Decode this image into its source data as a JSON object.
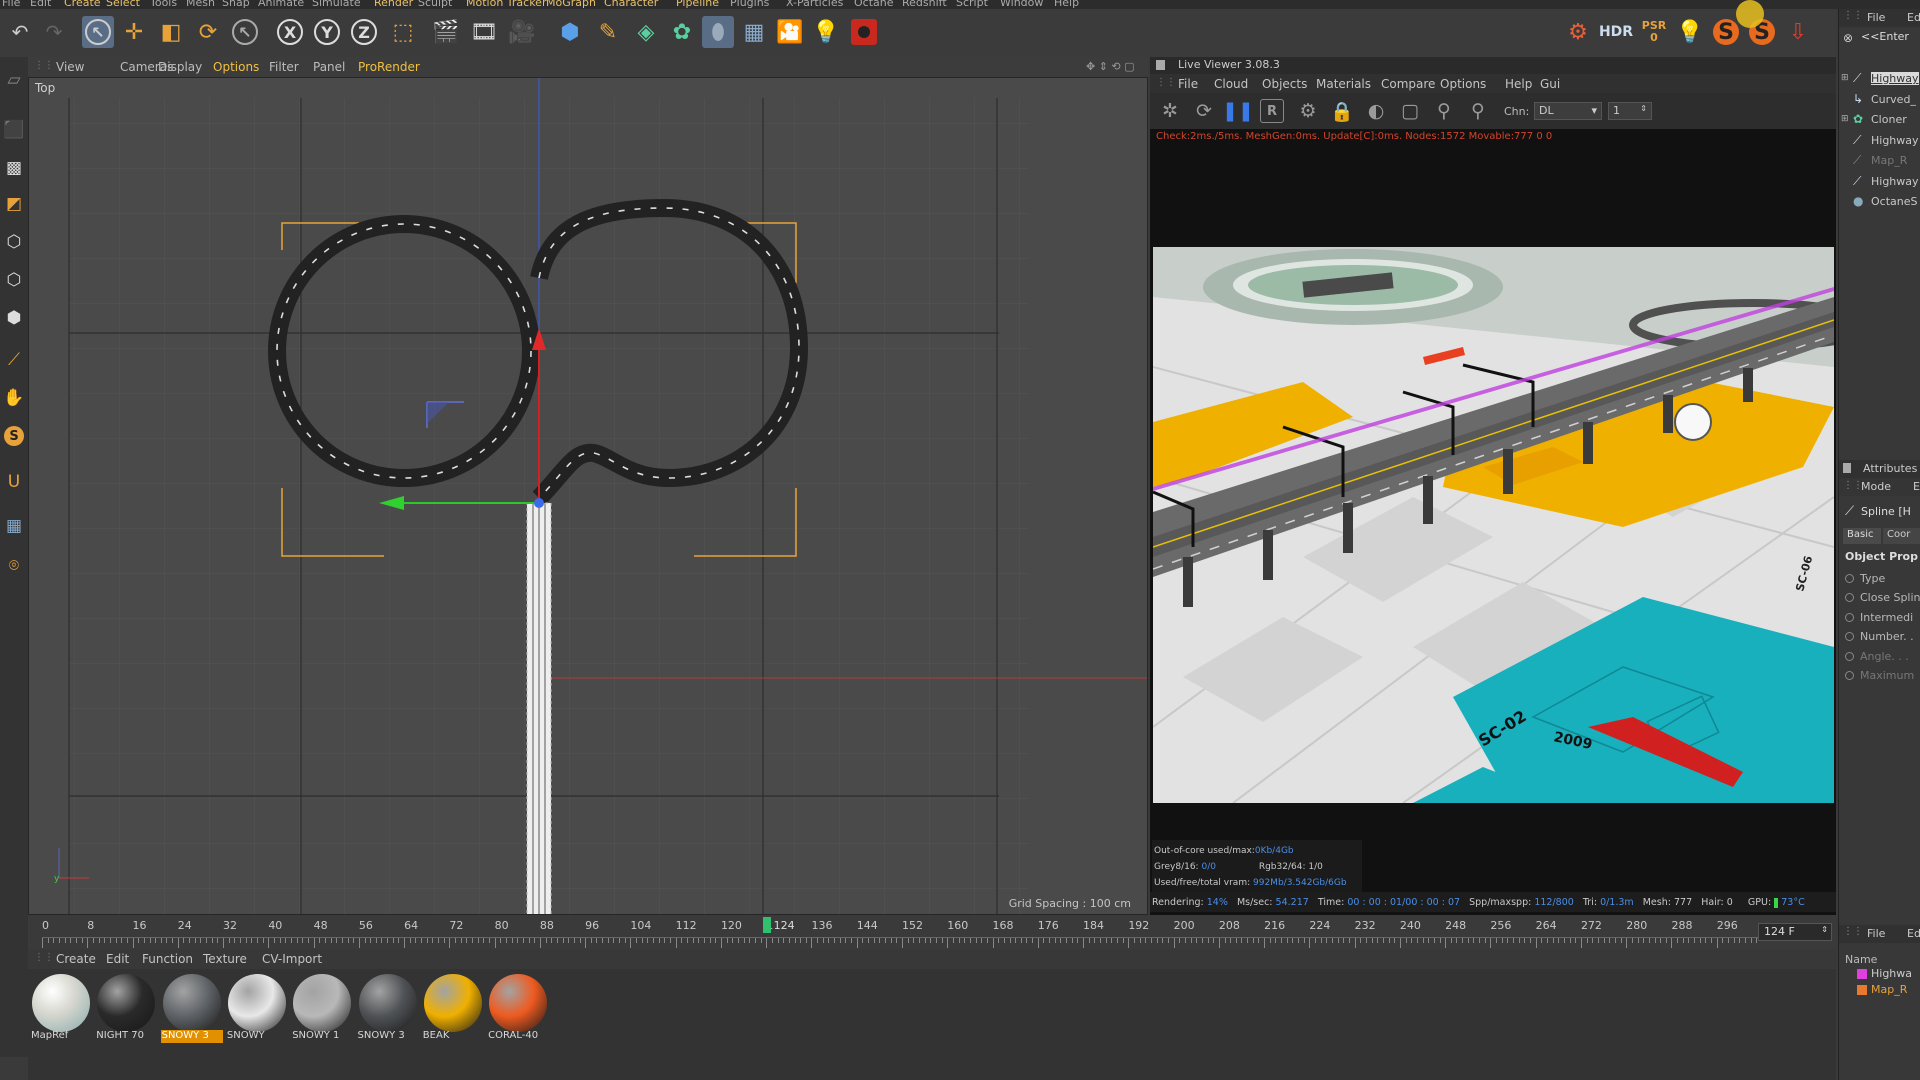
{
  "menubar": [
    "File",
    "Edit",
    "Create",
    "Select",
    "Tools",
    "Mesh",
    "Snap",
    "Animate",
    "Simulate",
    "Render",
    "Sculpt",
    "Motion Tracker",
    "MoGraph",
    "Character",
    "Pipeline",
    "Plugins",
    "X-Particles",
    "Octane",
    "Redshift",
    "Script",
    "Window",
    "Help"
  ],
  "viewport": {
    "menu": [
      "View",
      "Cameras",
      "Display",
      "Options",
      "Filter",
      "Panel",
      "ProRender"
    ],
    "label": "Top",
    "grid_spacing": "Grid Spacing : 100 cm"
  },
  "live_viewer": {
    "title": "Live Viewer 3.08.3",
    "menu": [
      "File",
      "Cloud",
      "Objects",
      "Materials",
      "Compare",
      "Options",
      "Help",
      "Gui"
    ],
    "chn_label": "Chn:",
    "chn_value": "DL",
    "chn_num": "1",
    "status": "Check:2ms./5ms. MeshGen:0ms. Update[C]:0ms. Nodes:1572 Movable:777  0 0",
    "render_labels": [
      "SC-02",
      "2009",
      "SC-06"
    ],
    "info": {
      "ooc_label": "Out-of-core used/max:",
      "ooc_value": "0Kb/4Gb",
      "grey_label": "Grey8/16:",
      "grey_value": "0/0",
      "rgb_label": "Rgb32/64:",
      "rgb_value": "1/0",
      "vram_label": "Used/free/total vram:",
      "vram_value": "992Mb/3.542Gb/6Gb"
    },
    "bottom": {
      "rendering": "Rendering:",
      "rendering_v": "14%",
      "mssec": "Ms/sec:",
      "mssec_v": "54.217",
      "time": "Time:",
      "time_v": "00 : 00 : 01/00 : 00 : 07",
      "spp": "Spp/maxspp:",
      "spp_v": "112/800",
      "tri": "Tri:",
      "tri_v": "0/1.3m",
      "mesh": "Mesh:",
      "mesh_v": "777",
      "hair": "Hair:",
      "hair_v": "0",
      "gpu": "GPU:",
      "gpu_v": "73°C"
    }
  },
  "object_manager": {
    "menu": [
      "File",
      "Edit"
    ],
    "search": "<<Enter",
    "items": [
      "Highway",
      "Curved_",
      "Cloner",
      "Highway",
      "Map_R",
      "Highway",
      "OctaneS"
    ]
  },
  "attributes": {
    "title": "Attributes",
    "mode": "Mode",
    "mode2": "E",
    "object": "Spline [H",
    "tabs": [
      "Basic",
      "Coor"
    ],
    "section": "Object Prop",
    "rows": [
      "Type",
      "Close Splin",
      "Intermedi",
      "Number. .",
      "Angle. . .",
      "Maximum"
    ]
  },
  "layers": {
    "menu": [
      "File",
      "Edit"
    ],
    "name_hdr": "Name",
    "items": [
      "Highwa",
      "Map_R"
    ]
  },
  "timeline": {
    "ticks": [
      "0",
      "8",
      "16",
      "24",
      "32",
      "40",
      "48",
      "56",
      "64",
      "72",
      "80",
      "88",
      "96",
      "104",
      "112",
      "120",
      "128",
      "136",
      "144",
      "152",
      "160",
      "168",
      "176",
      "184",
      "192",
      "200",
      "208",
      "216",
      "224",
      "232",
      "240",
      "248",
      "256",
      "264",
      "272",
      "280",
      "288",
      "296"
    ],
    "current": "124",
    "current_frac": 0.419,
    "end": "124 F"
  },
  "materials": {
    "menu": [
      "Create",
      "Edit",
      "Function",
      "Texture",
      "CV-Import"
    ],
    "items": [
      {
        "name": "MapRef",
        "color": "#d8d8d0"
      },
      {
        "name": "NIGHT 70",
        "color": "#2a2a2a"
      },
      {
        "name": "SNOWY 3",
        "color": "#606468"
      },
      {
        "name": "SNOWY",
        "color": "#e8e8e8"
      },
      {
        "name": "SNOWY 1",
        "color": "#b8b8b8"
      },
      {
        "name": "SNOWY 3",
        "color": "#505356"
      },
      {
        "name": "BEAK",
        "color": "#f0b000"
      },
      {
        "name": "CORAL-40",
        "color": "#ee5a20"
      }
    ],
    "selected_index": 2
  },
  "colors": {
    "accent": "#f0c040",
    "selection": "#5a6d86",
    "render_yellow": "#f0b000",
    "render_teal": "#18b0bc"
  }
}
